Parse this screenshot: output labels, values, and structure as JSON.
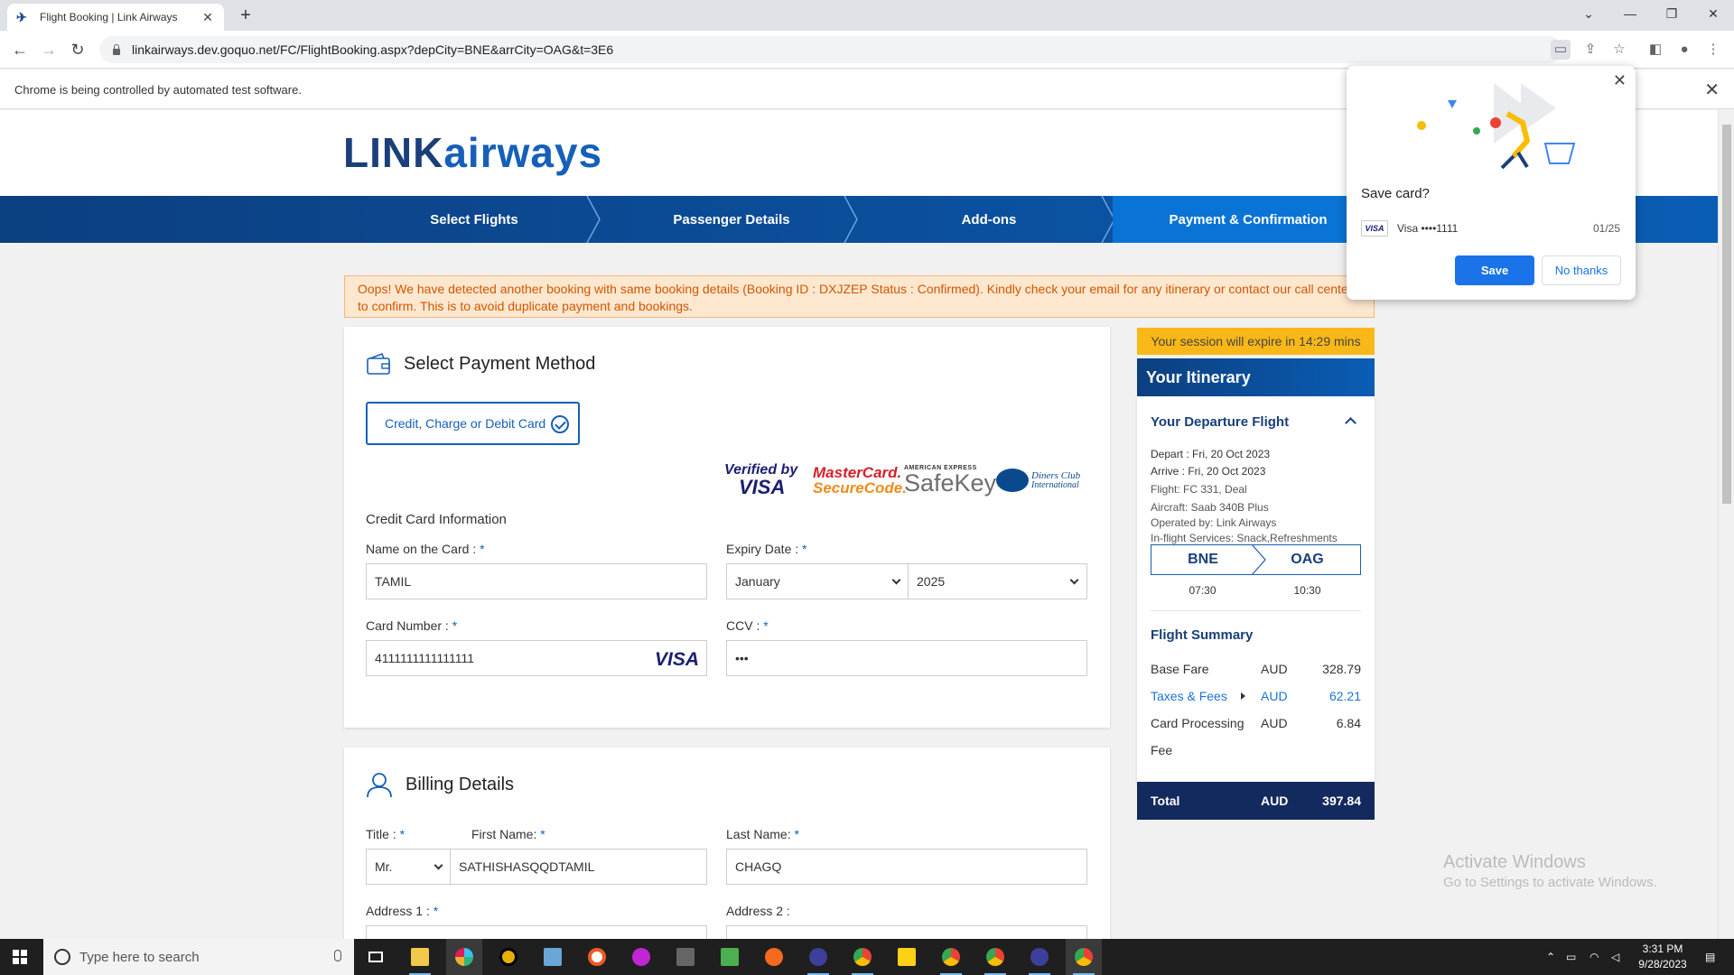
{
  "browser": {
    "tab_title": "Flight Booking | Link Airways",
    "new_tab": "+",
    "url": "linkairways.dev.goquo.net/FC/FlightBooking.aspx?depCity=BNE&arrCity=OAG&t=3E6",
    "infobar_text": "Chrome is being controlled by automated test software."
  },
  "site": {
    "logo_part1": "LINK",
    "logo_part2": "airways",
    "steps": [
      "Select Flights",
      "Passenger Details",
      "Add-ons",
      "Payment & Confirmation"
    ],
    "active_step": 3,
    "alert": "Oops! We have detected another booking with same booking details (Booking ID : DXJZEP Status : Confirmed). Kindly check your email for any itinerary or contact our call center to confirm. This is to avoid duplicate payment and bookings."
  },
  "payment": {
    "title": "Select Payment Method",
    "method": "Credit, Charge or Debit Card",
    "secure_logos": {
      "verified_top": "Verified by",
      "verified_bottom": "VISA",
      "mc_top": "MasterCard.",
      "mc_bottom": "SecureCode.",
      "amex_top": "AMERICAN EXPRESS",
      "amex_bottom": "SafeKey",
      "diners_top": "Diners Club",
      "diners_bottom": "International"
    },
    "section": "Credit Card Information",
    "name_label": "Name on the Card :",
    "name_value": "TAMIL",
    "expiry_label": "Expiry Date :",
    "expiry_month": "January",
    "expiry_year": "2025",
    "card_label": "Card Number :",
    "card_value": "4111111111111111",
    "card_brand": "VISA",
    "ccv_label": "CCV :",
    "ccv_value": "•••",
    "required": "*"
  },
  "billing": {
    "title": "Billing Details",
    "title_label": "Title :",
    "title_value": "Mr.",
    "first_label": "First Name:",
    "first_value": "SATHISHASQQDTAMIL",
    "last_label": "Last Name:",
    "last_value": "CHAGQ",
    "addr1_label": "Address 1 :",
    "addr2_label": "Address 2 :"
  },
  "itinerary": {
    "session": "Your session will expire in 14:29 mins",
    "title": "Your Itinerary",
    "departure_title": "Your Departure Flight",
    "depart": "Depart : Fri, 20 Oct 2023",
    "arrive": "Arrive : Fri, 20 Oct 2023",
    "flight": "Flight: FC 331, Deal",
    "aircraft": "Aircraft: Saab 340B Plus",
    "operated": "Operated by: Link Airways",
    "services": "In-flight Services: Snack,Refreshments",
    "from_code": "BNE",
    "to_code": "OAG",
    "from_time": "07:30",
    "to_time": "10:30",
    "summary_title": "Flight Summary",
    "rows": [
      {
        "name": "Base Fare",
        "currency": "AUD",
        "value": "328.79"
      },
      {
        "name": "Taxes & Fees",
        "currency": "AUD",
        "value": "62.21"
      },
      {
        "name": "Card Processing",
        "currency": "AUD",
        "value": "6.84"
      }
    ],
    "fee_wrap": "Fee",
    "total_label": "Total",
    "total_currency": "AUD",
    "total_value": "397.84"
  },
  "popup": {
    "title": "Save card?",
    "card_badge": "VISA",
    "card_name": "Visa  ••••1111",
    "card_exp": "01/25",
    "save": "Save",
    "no_thanks": "No thanks"
  },
  "watermark": {
    "line1": "Activate Windows",
    "line2": "Go to Settings to activate Windows."
  },
  "taskbar": {
    "search_placeholder": "Type here to search",
    "time": "3:31 PM",
    "date": "9/28/2023"
  },
  "colors": {
    "brand_dark": "#1a3f7a",
    "brand_blue": "#1560b8",
    "alert_bg": "#fde8cf",
    "session_bg": "#f9b817",
    "total_bg": "#132a5e",
    "chrome_blue": "#1a73e8"
  }
}
